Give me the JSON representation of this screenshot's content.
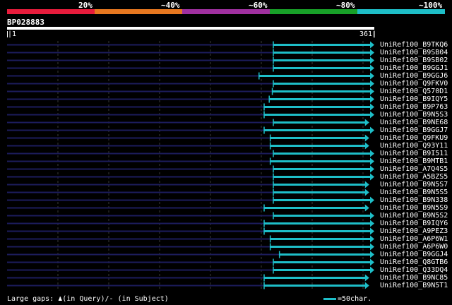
{
  "query": {
    "name": "BP028883",
    "start": "|1",
    "end": "361|"
  },
  "identity_scale": {
    "segments": [
      {
        "label": "20%",
        "color": "#e81c3c"
      },
      {
        "label": "~40%",
        "color": "#e87820"
      },
      {
        "label": "~60%",
        "color": "#a030a0"
      },
      {
        "label": "~80%",
        "color": "#18a028"
      },
      {
        "label": "~100%",
        "color": "#1ebec8"
      }
    ]
  },
  "colors": {
    "background": "#000000",
    "gap_line": "#1c1c5c",
    "grid": "#3a3a3a",
    "hit": "#1ebec8"
  },
  "chart_data": {
    "type": "bar",
    "x_range": [
      1,
      361
    ],
    "hits": [
      {
        "label": "UniRef100_B9TKQ6",
        "start": 262,
        "end": 361
      },
      {
        "label": "UniRef100_B9SB04",
        "start": 262,
        "end": 361
      },
      {
        "label": "UniRef100_B9SB02",
        "start": 262,
        "end": 361
      },
      {
        "label": "UniRef100_B9GGJ1",
        "start": 262,
        "end": 361
      },
      {
        "label": "UniRef100_B9GGJ6",
        "start": 248,
        "end": 361
      },
      {
        "label": "UniRef100_Q9FKV0",
        "start": 262,
        "end": 361
      },
      {
        "label": "UniRef100_Q570D1",
        "start": 261,
        "end": 361
      },
      {
        "label": "UniRef100_B9IQY5",
        "start": 258,
        "end": 361
      },
      {
        "label": "UniRef100_B9P763",
        "start": 253,
        "end": 361
      },
      {
        "label": "UniRef100_B9N5S3",
        "start": 253,
        "end": 361
      },
      {
        "label": "UniRef100_B9NE68",
        "start": 262,
        "end": 356
      },
      {
        "label": "UniRef100_B9GGJ7",
        "start": 253,
        "end": 361
      },
      {
        "label": "UniRef100_Q9FKU9",
        "start": 259,
        "end": 356
      },
      {
        "label": "UniRef100_Q93Y11",
        "start": 259,
        "end": 356
      },
      {
        "label": "UniRef100_B9I511",
        "start": 262,
        "end": 361
      },
      {
        "label": "UniRef100_B9MTB1",
        "start": 259,
        "end": 361
      },
      {
        "label": "UniRef100_A7Q4S5",
        "start": 262,
        "end": 361
      },
      {
        "label": "UniRef100_A5BZS5",
        "start": 262,
        "end": 361
      },
      {
        "label": "UniRef100_B9N5S7",
        "start": 262,
        "end": 356
      },
      {
        "label": "UniRef100_B9N5S5",
        "start": 262,
        "end": 356
      },
      {
        "label": "UniRef100_B9N338",
        "start": 262,
        "end": 361
      },
      {
        "label": "UniRef100_B9N5S9",
        "start": 253,
        "end": 356
      },
      {
        "label": "UniRef100_B9N5S2",
        "start": 262,
        "end": 361
      },
      {
        "label": "UniRef100_B9IQY6",
        "start": 253,
        "end": 361
      },
      {
        "label": "UniRef100_A9PEZ3",
        "start": 253,
        "end": 361
      },
      {
        "label": "UniRef100_A6P6W1",
        "start": 259,
        "end": 361
      },
      {
        "label": "UniRef100_A6P6W0",
        "start": 259,
        "end": 361
      },
      {
        "label": "UniRef100_B9GGJ4",
        "start": 268,
        "end": 361
      },
      {
        "label": "UniRef100_Q8GTB6",
        "start": 262,
        "end": 361
      },
      {
        "label": "UniRef100_Q33DQ4",
        "start": 262,
        "end": 361
      },
      {
        "label": "UniRef100_B9NC85",
        "start": 253,
        "end": 356
      },
      {
        "label": "UniRef100_B9N5T1",
        "start": 253,
        "end": 356
      }
    ]
  },
  "legend": {
    "text": "Large gaps: ♟(in Query)/- (in Subject)",
    "key_label": "=50char."
  }
}
